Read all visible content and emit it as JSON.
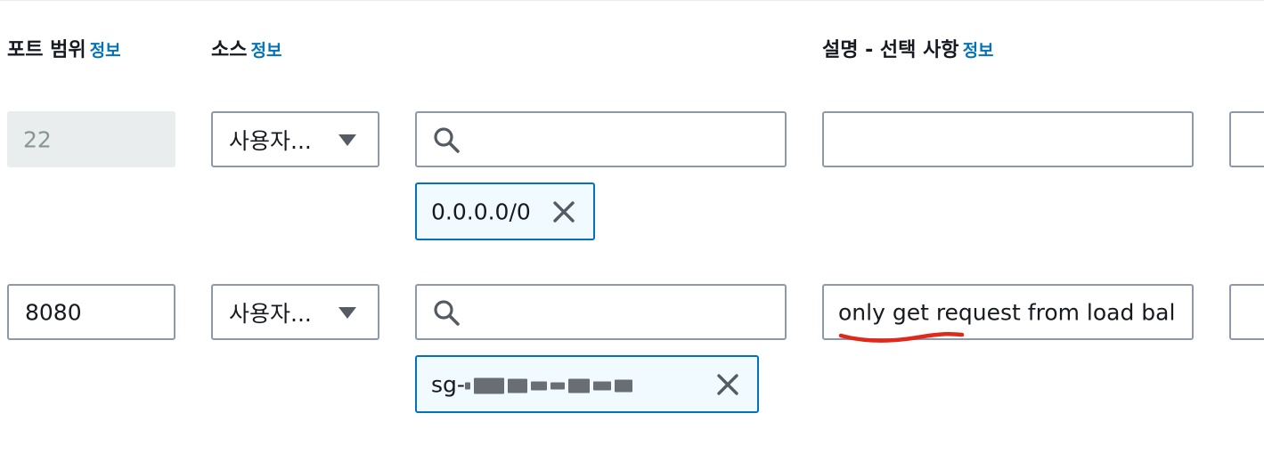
{
  "headers": {
    "port_range": "포트 범위",
    "source": "소스",
    "description": "설명 - 선택 사항",
    "info": "정보"
  },
  "rows": [
    {
      "port": "22",
      "port_disabled": true,
      "source_type": "사용자...",
      "search_value": "",
      "token": "0.0.0.0/0",
      "description": ""
    },
    {
      "port": "8080",
      "port_disabled": false,
      "source_type": "사용자...",
      "search_value": "",
      "token": "sg-",
      "token_obscured": true,
      "description": "only get request from load bal"
    }
  ],
  "colors": {
    "link": "#0073bb",
    "border": "#8d99a8",
    "token_border": "#0073bb",
    "token_bg": "#f1faff",
    "disabled_bg": "#eaeded",
    "annotation": "#e0281b"
  },
  "icons": {
    "search": "search-icon",
    "dropdown": "caret-down-icon",
    "remove": "close-icon"
  }
}
